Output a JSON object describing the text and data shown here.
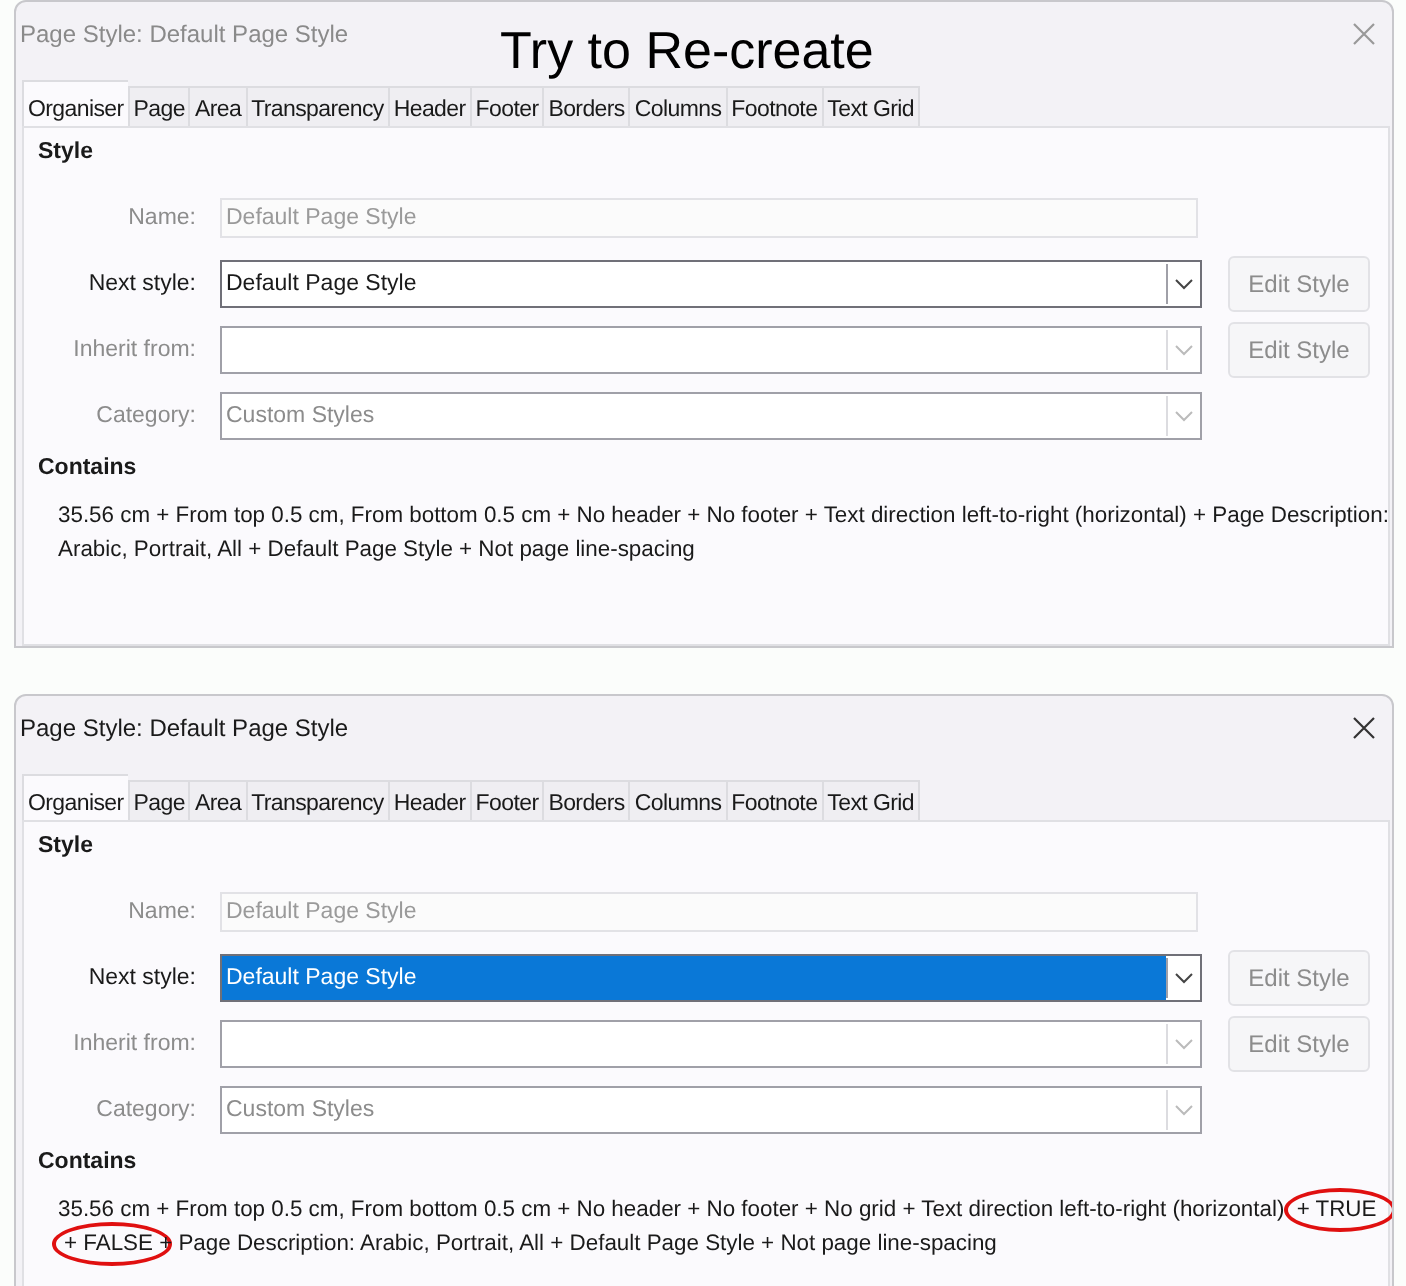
{
  "annotation_title": "Try to Re-create",
  "dialogs": [
    {
      "title": "Page Style: Default Page Style",
      "active": false,
      "tabs": [
        {
          "label": "Organiser",
          "selected": true
        },
        {
          "label": "Page",
          "selected": false
        },
        {
          "label": "Area",
          "selected": false
        },
        {
          "label": "Transparency",
          "selected": false
        },
        {
          "label": "Header",
          "selected": false
        },
        {
          "label": "Footer",
          "selected": false
        },
        {
          "label": "Borders",
          "selected": false
        },
        {
          "label": "Columns",
          "selected": false
        },
        {
          "label": "Footnote",
          "selected": false
        },
        {
          "label": "Text Grid",
          "selected": false
        }
      ],
      "section": "Style",
      "fields": [
        {
          "kind": "text",
          "label": "Name:",
          "value": "Default Page Style",
          "disabled": true
        },
        {
          "kind": "combo",
          "label": "Next style:",
          "value": "Default Page Style",
          "disabled": false,
          "highlighted": false,
          "button": "Edit Style"
        },
        {
          "kind": "combo",
          "label": "Inherit from:",
          "disabled": true,
          "highlighted": false,
          "button": "Edit Style"
        },
        {
          "kind": "combo",
          "label": "Category:",
          "value": "Custom Styles",
          "disabled": true,
          "highlighted": false
        }
      ],
      "contains_heading": "Contains",
      "contains_parts": [
        {
          "text": "35.56 cm + From top 0.5 cm, From bottom 0.5 cm + No header + No footer + Text direction left-to-right (horizontal) + Page Description: Arabic, Portrait, All + Default Page Style + Not page line-spacing",
          "circled": false
        }
      ]
    },
    {
      "title": "Page Style: Default Page Style",
      "active": true,
      "tabs": [
        {
          "label": "Organiser",
          "selected": true
        },
        {
          "label": "Page",
          "selected": false
        },
        {
          "label": "Area",
          "selected": false
        },
        {
          "label": "Transparency",
          "selected": false
        },
        {
          "label": "Header",
          "selected": false
        },
        {
          "label": "Footer",
          "selected": false
        },
        {
          "label": "Borders",
          "selected": false
        },
        {
          "label": "Columns",
          "selected": false
        },
        {
          "label": "Footnote",
          "selected": false
        },
        {
          "label": "Text Grid",
          "selected": false
        }
      ],
      "section": "Style",
      "fields": [
        {
          "kind": "text",
          "label": "Name:",
          "value": "Default Page Style",
          "disabled": true
        },
        {
          "kind": "combo",
          "label": "Next style:",
          "value": "Default Page Style",
          "disabled": false,
          "highlighted": true,
          "button": "Edit Style"
        },
        {
          "kind": "combo",
          "label": "Inherit from:",
          "disabled": true,
          "highlighted": false,
          "button": "Edit Style"
        },
        {
          "kind": "combo",
          "label": "Category:",
          "value": "Custom Styles",
          "disabled": true,
          "highlighted": false
        }
      ],
      "contains_heading": "Contains",
      "contains_parts": [
        {
          "text": "35.56 cm + From top 0.5 cm, From bottom 0.5 cm + No header + No footer + No grid + Text direction left-to-right (horizontal)",
          "circled": false
        },
        {
          "text": "+ TRUE",
          "circled": true
        },
        {
          "text": "+ FALSE",
          "circled": true
        },
        {
          "text": "+ Page Description: Arabic, Portrait, All + Default Page Style + Not page line-spacing",
          "circled": false
        }
      ]
    }
  ]
}
